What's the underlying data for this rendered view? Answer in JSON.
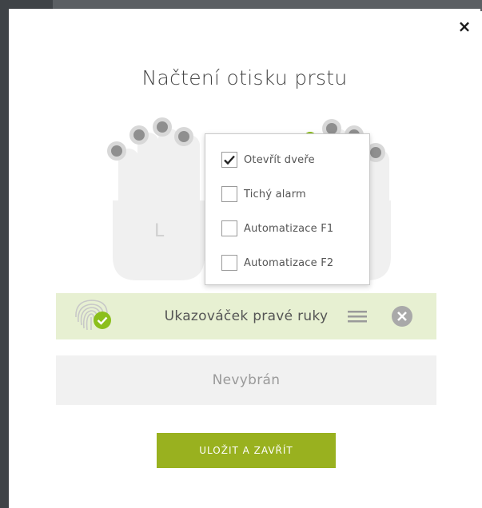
{
  "dialog": {
    "title": "Načtení otisku prstu",
    "close_label": "×"
  },
  "hands": {
    "left_hand_letter": "L"
  },
  "action_menu": {
    "items": [
      {
        "label": "Otevřít dveře",
        "checked": true
      },
      {
        "label": "Tichý alarm",
        "checked": false
      },
      {
        "label": "Automatizace F1",
        "checked": false
      },
      {
        "label": "Automatizace F2",
        "checked": false
      }
    ]
  },
  "finger_row": {
    "label": "Ukazováček pravé ruky",
    "status": "registered"
  },
  "second_row": {
    "label": "Nevybrán"
  },
  "save_button": {
    "label": "ULOŽIT A ZAVŘÍT"
  },
  "colors": {
    "accent": "#99b11f",
    "success": "#8bbf1c",
    "row_bg": "#e7f0d2",
    "finger_marker": "#8f8f8f"
  }
}
